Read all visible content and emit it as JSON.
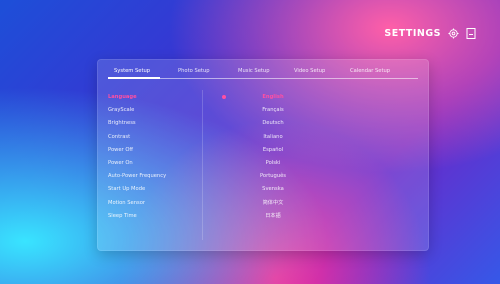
{
  "header": {
    "title": "SETTINGS",
    "icons": [
      "settings-gear-icon",
      "file-icon"
    ]
  },
  "tabs": [
    {
      "label": "System Setup",
      "active": true
    },
    {
      "label": "Photo Setup",
      "active": false
    },
    {
      "label": "Music Setup",
      "active": false
    },
    {
      "label": "Video Setup",
      "active": false
    },
    {
      "label": "Calendar Setup",
      "active": false
    }
  ],
  "menu": [
    {
      "label": "Language",
      "active": true
    },
    {
      "label": "GrayScale",
      "active": false
    },
    {
      "label": "Brightness",
      "active": false
    },
    {
      "label": "Contrast",
      "active": false
    },
    {
      "label": "Power Off",
      "active": false
    },
    {
      "label": "Power On",
      "active": false
    },
    {
      "label": "Auto-Power Frequency",
      "active": false
    },
    {
      "label": "Start Up Mode",
      "active": false
    },
    {
      "label": "Motion Sensor",
      "active": false
    },
    {
      "label": "Sleep Time",
      "active": false
    }
  ],
  "languages": [
    {
      "label": "English",
      "selected": true
    },
    {
      "label": "Français",
      "selected": false
    },
    {
      "label": "Deutsch",
      "selected": false
    },
    {
      "label": "Italiano",
      "selected": false
    },
    {
      "label": "Español",
      "selected": false
    },
    {
      "label": "Polski",
      "selected": false
    },
    {
      "label": "Português",
      "selected": false
    },
    {
      "label": "Svenska",
      "selected": false
    },
    {
      "label": "简体中文",
      "selected": false
    },
    {
      "label": "日本語",
      "selected": false
    }
  ],
  "colors": {
    "accent": "#ff4fa3",
    "text": "#ffffff"
  }
}
